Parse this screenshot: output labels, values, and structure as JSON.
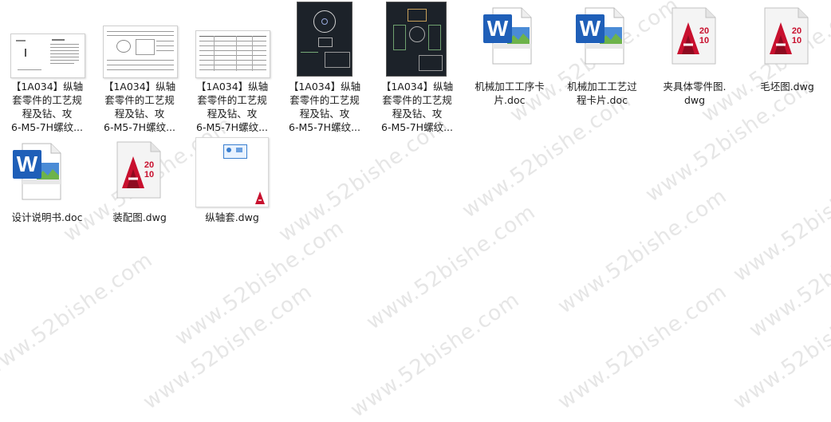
{
  "watermark": {
    "text": "www.52bishe.com"
  },
  "files": [
    {
      "name": "【1A034】纵轴套零件的工艺规程及钻、攻6-M5-7H螺纹...",
      "lines": [
        "【1A034】纵轴",
        "套零件的工艺规",
        "程及钻、攻",
        "6-M5-7H螺纹..."
      ],
      "icon": "document-thumbnail-icon"
    },
    {
      "name": "【1A034】纵轴套零件的工艺规程及钻、攻6-M5-7H螺纹...",
      "lines": [
        "【1A034】纵轴",
        "套零件的工艺规",
        "程及钻、攻",
        "6-M5-7H螺纹..."
      ],
      "icon": "process-card-thumbnail-icon"
    },
    {
      "name": "【1A034】纵轴套零件的工艺规程及钻、攻6-M5-7H螺纹...",
      "lines": [
        "【1A034】纵轴",
        "套零件的工艺规",
        "程及钻、攻",
        "6-M5-7H螺纹..."
      ],
      "icon": "table-thumbnail-icon"
    },
    {
      "name": "【1A034】纵轴套零件的工艺规程及钻、攻6-M5-7H螺纹...",
      "lines": [
        "【1A034】纵轴",
        "套零件的工艺规",
        "程及钻、攻",
        "6-M5-7H螺纹..."
      ],
      "icon": "cad-drawing-thumbnail-icon"
    },
    {
      "name": "【1A034】纵轴套零件的工艺规程及钻、攻6-M5-7H螺纹...",
      "lines": [
        "【1A034】纵轴",
        "套零件的工艺规",
        "程及钻、攻",
        "6-M5-7H螺纹..."
      ],
      "icon": "cad-drawing-thumbnail-icon"
    },
    {
      "name": "机械加工工序卡片.doc",
      "lines": [
        "机械加工工序卡",
        "片.doc"
      ],
      "icon": "word-doc-icon"
    },
    {
      "name": "机械加工工艺过程卡片.doc",
      "lines": [
        "机械加工工艺过",
        "程卡片.doc"
      ],
      "icon": "word-doc-icon"
    },
    {
      "name": "夹具体零件图.dwg",
      "lines": [
        "夹具体零件图.",
        "dwg"
      ],
      "icon": "autocad-dwg-icon"
    },
    {
      "name": "毛坯图.dwg",
      "lines": [
        "毛坯图.dwg"
      ],
      "icon": "autocad-dwg-icon"
    },
    {
      "name": "设计说明书.doc",
      "lines": [
        "设计说明书.doc"
      ],
      "icon": "word-doc-icon"
    },
    {
      "name": "装配图.dwg",
      "lines": [
        "装配图.dwg"
      ],
      "icon": "autocad-dwg-icon"
    },
    {
      "name": "纵轴套.dwg",
      "lines": [
        "纵轴套.dwg"
      ],
      "icon": "dwg-thumbnail-icon"
    }
  ],
  "colors": {
    "word_blue": "#1f5fb8",
    "autocad_red": "#c8102e",
    "cad_bg": "#1c2229"
  },
  "autocad_badge": {
    "top": "20",
    "bottom": "10",
    "letter": "A"
  },
  "word_badge": {
    "letter": "W"
  }
}
